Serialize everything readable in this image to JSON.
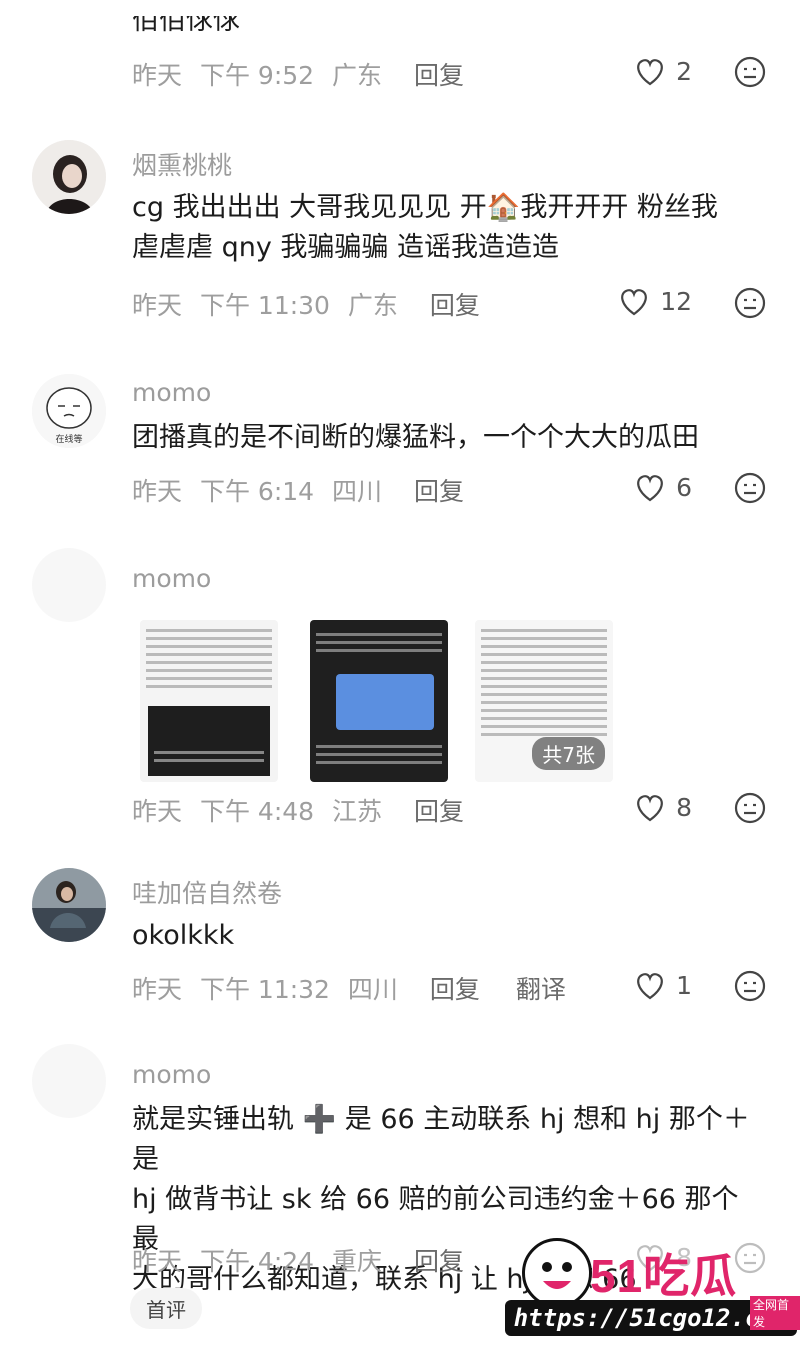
{
  "top_fragment": "佰佰俅俅",
  "comments": [
    {
      "date": "昨天",
      "time": "下午 9:52",
      "location": "广东",
      "reply": "回复",
      "likes": "2"
    },
    {
      "name": "烟熏桃桃",
      "line1": "cg 我出出出 大哥我见见见 开🏠我开开开 粉丝我",
      "line2": "虐虐虐 qny 我骗骗骗 造谣我造造造",
      "date": "昨天",
      "time": "下午 11:30",
      "location": "广东",
      "reply": "回复",
      "likes": "12"
    },
    {
      "name": "momo",
      "avatar_label": "在线等",
      "line1": "团播真的是不间断的爆猛料，一个个大大的瓜田",
      "date": "昨天",
      "time": "下午 6:14",
      "location": "四川",
      "reply": "回复",
      "likes": "6"
    },
    {
      "name": "momo",
      "image_count_badge": "共7张",
      "date": "昨天",
      "time": "下午 4:48",
      "location": "江苏",
      "reply": "回复",
      "likes": "8"
    },
    {
      "name": "哇加倍自然卷",
      "line1": "okolkkk",
      "date": "昨天",
      "time": "下午 11:32",
      "location": "四川",
      "reply": "回复",
      "translate": "翻译",
      "likes": "1"
    },
    {
      "name": "momo",
      "line1": "就是实锤出轨 ➕ 是 66 主动联系 hj 想和 hj 那个＋是",
      "line2": "hj 做背书让 sk 给 66 赔的前公司违约金＋66 那个最",
      "line3": "大的哥什么都知道，联系 hj 让 hj 原谅 66",
      "date": "昨天",
      "time": "下午 4:24",
      "location": "重庆",
      "reply": "回复",
      "likes": "8"
    }
  ],
  "first_comment_label": "首评",
  "watermark": {
    "logo": "51吃瓜",
    "tag": "全网首发",
    "url": "https://51cgo12.com"
  },
  "colors": {
    "meta": "#9e9e9e",
    "name": "#9c9c9c",
    "text": "#1c1c1c",
    "watermark_pink": "#e0256a"
  }
}
